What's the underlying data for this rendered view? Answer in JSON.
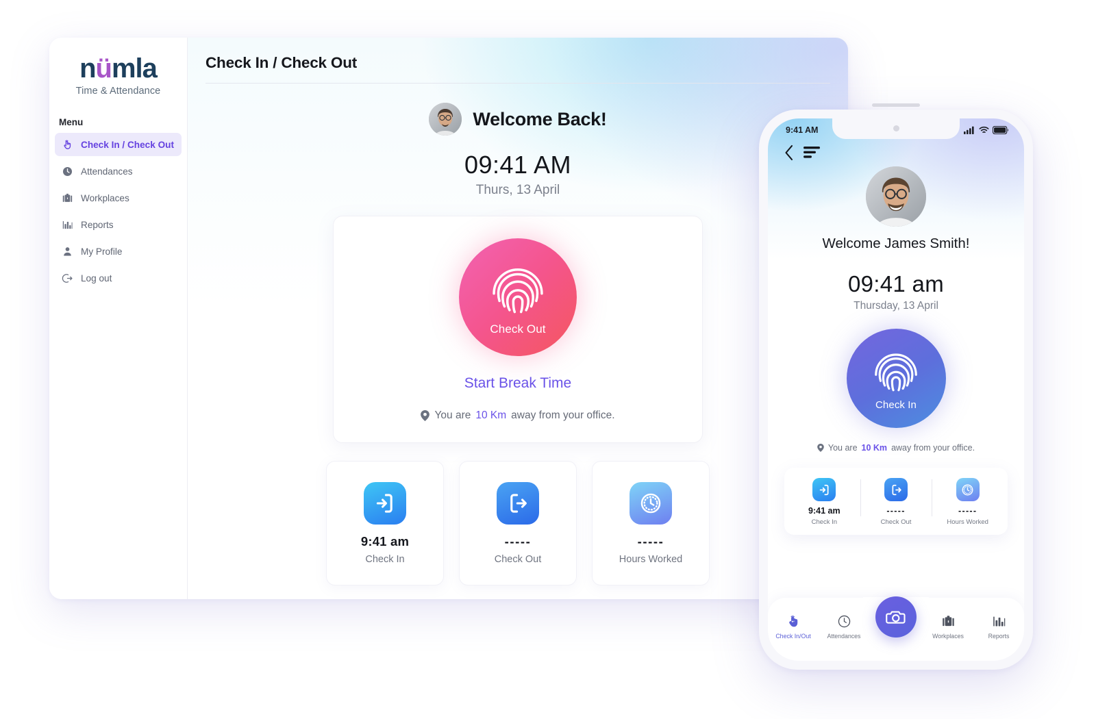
{
  "brand": {
    "logo_part1": "n",
    "logo_part2": "ü",
    "logo_part3": "mla",
    "tagline": "Time & Attendance"
  },
  "sidebar": {
    "menu_label": "Menu",
    "items": [
      {
        "label": "Check In / Check Out",
        "icon": "tap-hand-icon",
        "active": true
      },
      {
        "label": "Attendances",
        "icon": "clock-icon",
        "active": false
      },
      {
        "label": "Workplaces",
        "icon": "briefcase-icon",
        "active": false
      },
      {
        "label": "Reports",
        "icon": "bar-chart-icon",
        "active": false
      },
      {
        "label": "My Profile",
        "icon": "person-icon",
        "active": false
      },
      {
        "label": "Log out",
        "icon": "logout-icon",
        "active": false
      }
    ]
  },
  "desktop": {
    "page_title": "Check In / Check Out",
    "welcome": "Welcome Back!",
    "time": "09:41 AM",
    "date": "Thurs, 13 April",
    "fingerprint_button_label": "Check Out",
    "break_link": "Start Break Time",
    "office_note_prefix": "You are ",
    "office_note_distance": "10 Km",
    "office_note_suffix": " away from your office.",
    "stats": [
      {
        "icon": "check-in-icon",
        "value": "9:41 am",
        "label": "Check In",
        "dashes": false
      },
      {
        "icon": "check-out-icon",
        "value": "-----",
        "label": "Check Out",
        "dashes": true
      },
      {
        "icon": "clock-tile-icon",
        "value": "-----",
        "label": "Hours Worked",
        "dashes": true
      }
    ]
  },
  "phone": {
    "status_time": "9:41 AM",
    "welcome": "Welcome James Smith!",
    "time": "09:41 am",
    "date": "Thursday, 13 April",
    "fingerprint_button_label": "Check In",
    "office_note_prefix": "You are ",
    "office_note_distance": "10 Km",
    "office_note_suffix": " away from your office.",
    "stats": [
      {
        "icon": "check-in-icon",
        "value": "9:41 am",
        "label": "Check In",
        "dashes": false
      },
      {
        "icon": "check-out-icon",
        "value": "-----",
        "label": "Check Out",
        "dashes": true
      },
      {
        "icon": "clock-tile-icon",
        "value": "-----",
        "label": "Hours Worked",
        "dashes": true
      }
    ],
    "bottom_nav": [
      {
        "label": "Check In/Out",
        "icon": "tap-hand-icon",
        "active": true
      },
      {
        "label": "Attendances",
        "icon": "clock-icon",
        "active": false
      },
      {
        "label": "Workplaces",
        "icon": "briefcase-icon",
        "active": false
      },
      {
        "label": "Reports",
        "icon": "bar-chart-icon",
        "active": false
      }
    ],
    "fab_icon": "camera-icon"
  },
  "colors": {
    "accent_purple": "#6a52e8",
    "sidebar_active_bg": "#ece9fb",
    "checkout_pink": "#f4558e",
    "checkin_blue": "#5d6fdc",
    "tile_blue": "#2a7ef0",
    "logo_navy": "#1d3f5c",
    "logo_teal": "#1f9e8e",
    "logo_purple": "#a855c8"
  }
}
